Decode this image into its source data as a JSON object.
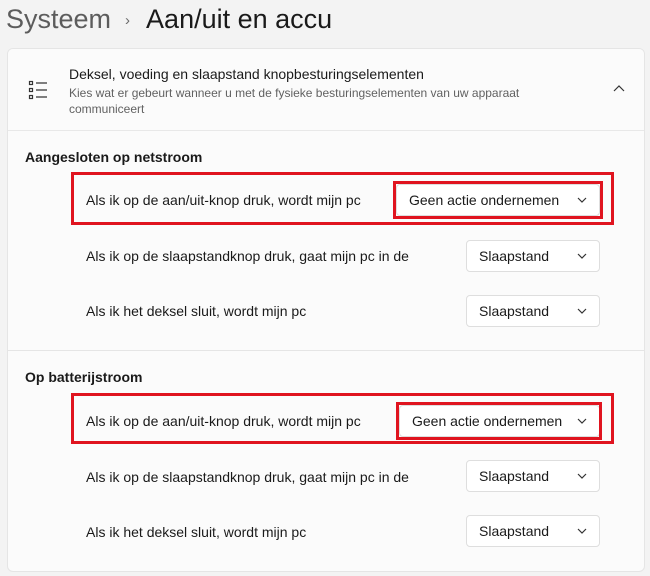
{
  "breadcrumb": {
    "parent": "Systeem",
    "separator": "›",
    "current": "Aan/uit en accu"
  },
  "header": {
    "title": "Deksel, voeding en slaapstand knopbesturingselementen",
    "description": "Kies wat er gebeurt wanneer u met de fysieke besturingselementen van uw apparaat communiceert",
    "icon": "list-settings-icon",
    "collapse_icon": "chevron-up-icon"
  },
  "plugged_in": {
    "title": "Aangesloten op netstroom",
    "power_button": {
      "label": "Als ik op de aan/uit-knop druk, wordt mijn pc",
      "value": "Geen actie ondernemen"
    },
    "sleep_button": {
      "label": "Als ik op de slaapstandknop druk, gaat mijn pc in de",
      "value": "Slaapstand"
    },
    "lid_close": {
      "label": "Als ik het deksel sluit, wordt mijn pc",
      "value": "Slaapstand"
    }
  },
  "on_battery": {
    "title": "Op batterijstroom",
    "power_button": {
      "label": "Als ik op de aan/uit-knop druk, wordt mijn pc",
      "value": "Geen actie ondernemen"
    },
    "sleep_button": {
      "label": "Als ik op de slaapstandknop druk, gaat mijn pc in de",
      "value": "Slaapstand"
    },
    "lid_close": {
      "label": "Als ik het deksel sluit, wordt mijn pc",
      "value": "Slaapstand"
    }
  },
  "colors": {
    "highlight": "#e0141f",
    "panel_bg": "#fbfbfb",
    "page_bg": "#f3f3f3"
  }
}
